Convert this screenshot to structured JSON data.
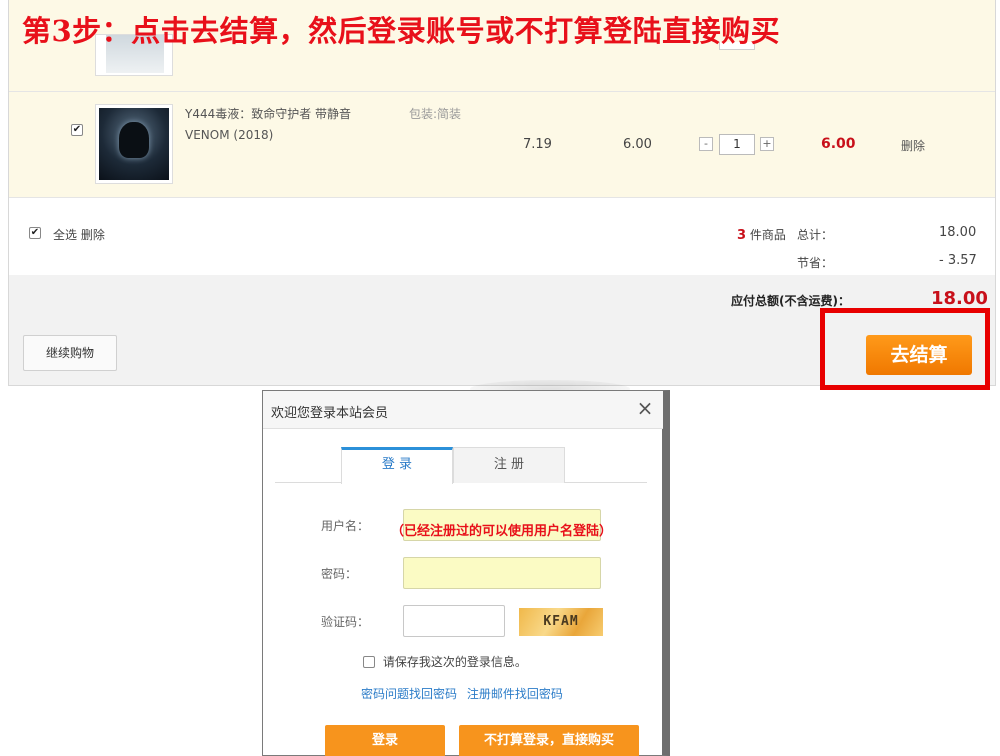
{
  "banner": {
    "step_title": "第3步：点击去结算，然后登录账号或不打算登陆直接购买"
  },
  "cart": {
    "item": {
      "name": "Y444毒液：致命守护者 带静音 VENOM (2018)",
      "package": "包装:简装",
      "list_price": "7.19",
      "price": "6.00",
      "qty_minus": "-",
      "quantity": "1",
      "qty_plus": "+",
      "subtotal": "6.00",
      "delete_label": "删除"
    },
    "select_all_label": "全选",
    "bulk_delete_label": "删除",
    "count_number": "3",
    "count_suffix": "件商品",
    "total_label": "总计：",
    "total_value": "18.00",
    "savings_label": "节省：",
    "savings_value": "- 3.57",
    "payable_label": "应付总额(不含运费)：",
    "payable_value": "18.00",
    "continue_label": "继续购物",
    "checkout_label": "去结算"
  },
  "dialog": {
    "title": "欢迎您登录本站会员",
    "close_icon": "×",
    "tabs": [
      {
        "label": "登 录"
      },
      {
        "label": "注 册"
      }
    ],
    "username_label": "用户名：",
    "username_hint": "（已经注册过的可以使用用户名登陆）",
    "password_label": "密码：",
    "captcha_label": "验证码：",
    "captcha_text": "KFAM",
    "remember_label": "请保存我这次的登录信息。",
    "link_question": "密码问题找回密码",
    "link_email": "注册邮件找回密码",
    "login_button": "登录",
    "guest_button": "不打算登录，直接购买"
  },
  "colors": {
    "accent_red": "#e8101a",
    "price_red": "#c8101a",
    "orange": "#f7941d",
    "link_blue": "#2b7cc8",
    "row_bg": "#fdf9e6"
  }
}
